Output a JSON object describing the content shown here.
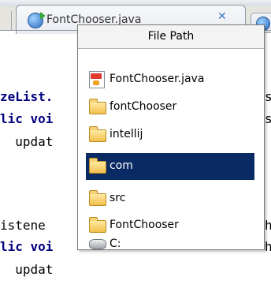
{
  "tab": {
    "title": "FontChooser.java",
    "close_glyph": "✕",
    "icon": "java-class-icon"
  },
  "editor_lines": [
    {
      "a": "zeList.",
      "b": ""
    },
    {
      "a": "lic ",
      "b": "voi"
    },
    {
      "a": "  updat",
      "b": ""
    },
    {
      "a": "",
      "b": ""
    },
    {
      "a": "istene",
      "b": ""
    },
    {
      "a": "lic ",
      "b": "voi"
    },
    {
      "a": "  updat",
      "b": ""
    }
  ],
  "editor_right_chars": [
    "s",
    "s",
    "",
    "",
    "h",
    "h",
    ""
  ],
  "popup": {
    "header": "File Path",
    "items": [
      {
        "label": "FontChooser.java",
        "icon": "java-file-icon"
      },
      {
        "label": "fontChooser",
        "icon": "folder-icon"
      },
      {
        "label": "intellij",
        "icon": "folder-icon"
      },
      {
        "label": "com",
        "icon": "folder-icon",
        "selected": true
      },
      {
        "label": "src",
        "icon": "folder-icon"
      },
      {
        "label": "FontChooser",
        "icon": "folder-icon"
      },
      {
        "label": "C:",
        "icon": "drive-icon"
      }
    ]
  },
  "colors": {
    "selection": "#0a2a63",
    "keyword": "#000080"
  }
}
